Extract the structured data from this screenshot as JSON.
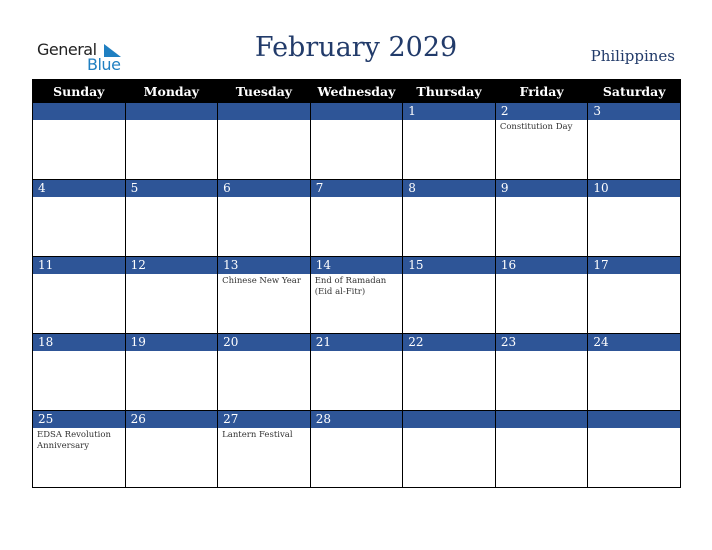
{
  "logo": {
    "line1": "General",
    "line2": "Blue"
  },
  "title": "February 2029",
  "country": "Philippines",
  "weekdays": [
    "Sunday",
    "Monday",
    "Tuesday",
    "Wednesday",
    "Thursday",
    "Friday",
    "Saturday"
  ],
  "weeks": [
    [
      {
        "d": "",
        "e": ""
      },
      {
        "d": "",
        "e": ""
      },
      {
        "d": "",
        "e": ""
      },
      {
        "d": "",
        "e": ""
      },
      {
        "d": "1",
        "e": ""
      },
      {
        "d": "2",
        "e": "Constitution Day"
      },
      {
        "d": "3",
        "e": ""
      }
    ],
    [
      {
        "d": "4",
        "e": ""
      },
      {
        "d": "5",
        "e": ""
      },
      {
        "d": "6",
        "e": ""
      },
      {
        "d": "7",
        "e": ""
      },
      {
        "d": "8",
        "e": ""
      },
      {
        "d": "9",
        "e": ""
      },
      {
        "d": "10",
        "e": ""
      }
    ],
    [
      {
        "d": "11",
        "e": ""
      },
      {
        "d": "12",
        "e": ""
      },
      {
        "d": "13",
        "e": "Chinese New Year"
      },
      {
        "d": "14",
        "e": "End of Ramadan (Eid al-Fitr)"
      },
      {
        "d": "15",
        "e": ""
      },
      {
        "d": "16",
        "e": ""
      },
      {
        "d": "17",
        "e": ""
      }
    ],
    [
      {
        "d": "18",
        "e": ""
      },
      {
        "d": "19",
        "e": ""
      },
      {
        "d": "20",
        "e": ""
      },
      {
        "d": "21",
        "e": ""
      },
      {
        "d": "22",
        "e": ""
      },
      {
        "d": "23",
        "e": ""
      },
      {
        "d": "24",
        "e": ""
      }
    ],
    [
      {
        "d": "25",
        "e": "EDSA Revolution Anniversary"
      },
      {
        "d": "26",
        "e": ""
      },
      {
        "d": "27",
        "e": "Lantern Festival"
      },
      {
        "d": "28",
        "e": ""
      },
      {
        "d": "",
        "e": ""
      },
      {
        "d": "",
        "e": ""
      },
      {
        "d": "",
        "e": ""
      }
    ]
  ]
}
